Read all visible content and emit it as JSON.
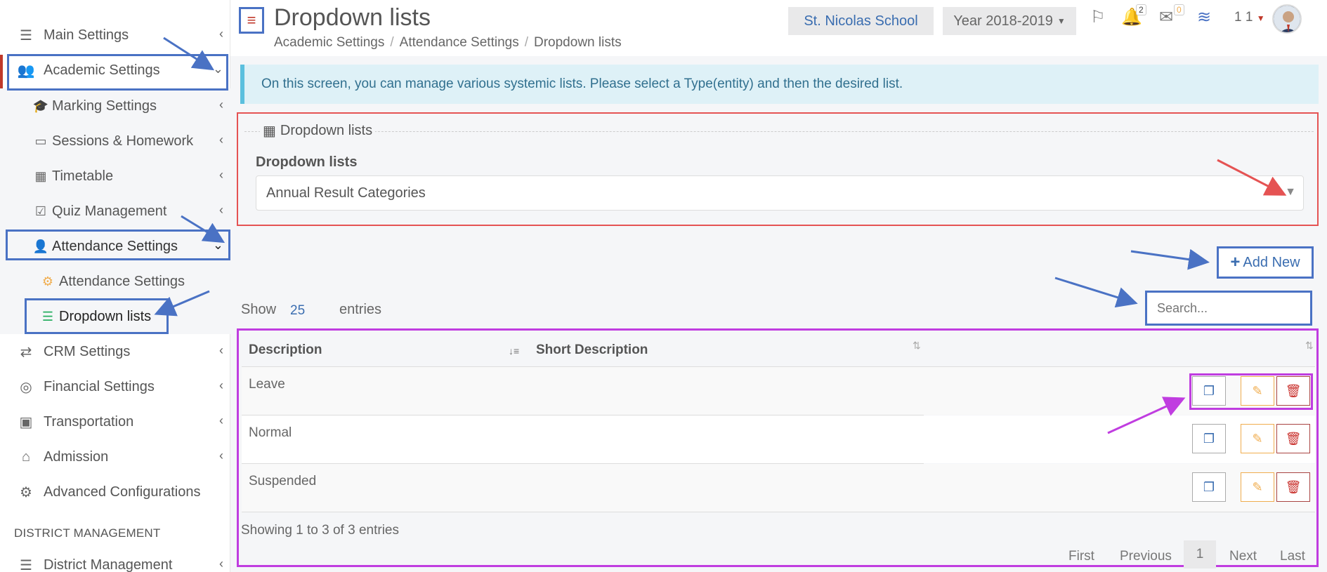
{
  "header": {
    "title": "Dropdown lists",
    "breadcrumb": [
      "Academic Settings",
      "Attendance Settings",
      "Dropdown lists"
    ],
    "school": "St. Nicolas School",
    "year": "Year 2018-2019",
    "notif_count": "2",
    "msg_count": "0",
    "user_count": "1 1"
  },
  "sidebar": {
    "items": [
      {
        "label": "Main Settings",
        "icon": "sliders-icon"
      },
      {
        "label": "Academic Settings",
        "icon": "users-icon"
      },
      {
        "label": "Marking Settings",
        "icon": "graduation-cap-icon"
      },
      {
        "label": "Sessions & Homework",
        "icon": "teacher-icon"
      },
      {
        "label": "Timetable",
        "icon": "calendar-icon"
      },
      {
        "label": "Quiz Management",
        "icon": "checkbox-icon"
      },
      {
        "label": "Attendance Settings",
        "icon": "user-x-icon"
      },
      {
        "label": "Attendance Settings",
        "icon": "gear-icon"
      },
      {
        "label": "Dropdown lists",
        "icon": "list-icon"
      },
      {
        "label": "CRM Settings",
        "icon": "shuffle-icon"
      },
      {
        "label": "Financial Settings",
        "icon": "coins-icon"
      },
      {
        "label": "Transportation",
        "icon": "bus-icon"
      },
      {
        "label": "Admission",
        "icon": "bank-icon"
      },
      {
        "label": "Advanced Configurations",
        "icon": "gears-icon"
      },
      {
        "label": "District Management",
        "icon": "menu-icon"
      }
    ],
    "section_label": "DISTRICT MANAGEMENT"
  },
  "info_alert": "On this screen, you can manage various systemic lists. Please select a Type(entity) and then the desired list.",
  "panel": {
    "legend": "Dropdown lists",
    "field_label": "Dropdown lists",
    "selected": "Annual Result Categories"
  },
  "toolbar": {
    "add_new": "Add New",
    "show": "Show",
    "page_size": "25",
    "entries": "entries",
    "search_placeholder": "Search..."
  },
  "table": {
    "columns": [
      "Description",
      "Short Description"
    ],
    "rows": [
      {
        "description": "Leave",
        "short": ""
      },
      {
        "description": "Normal",
        "short": ""
      },
      {
        "description": "Suspended",
        "short": ""
      }
    ],
    "info": "Showing 1 to 3 of 3 entries",
    "pagination": {
      "first": "First",
      "previous": "Previous",
      "current": "1",
      "next": "Next",
      "last": "Last"
    }
  },
  "colors": {
    "accent": "#3a6db0",
    "annotation_blue": "#4a72c4",
    "annotation_red": "#e55353",
    "annotation_purple": "#c03de0",
    "info_bg": "#def1f7"
  }
}
